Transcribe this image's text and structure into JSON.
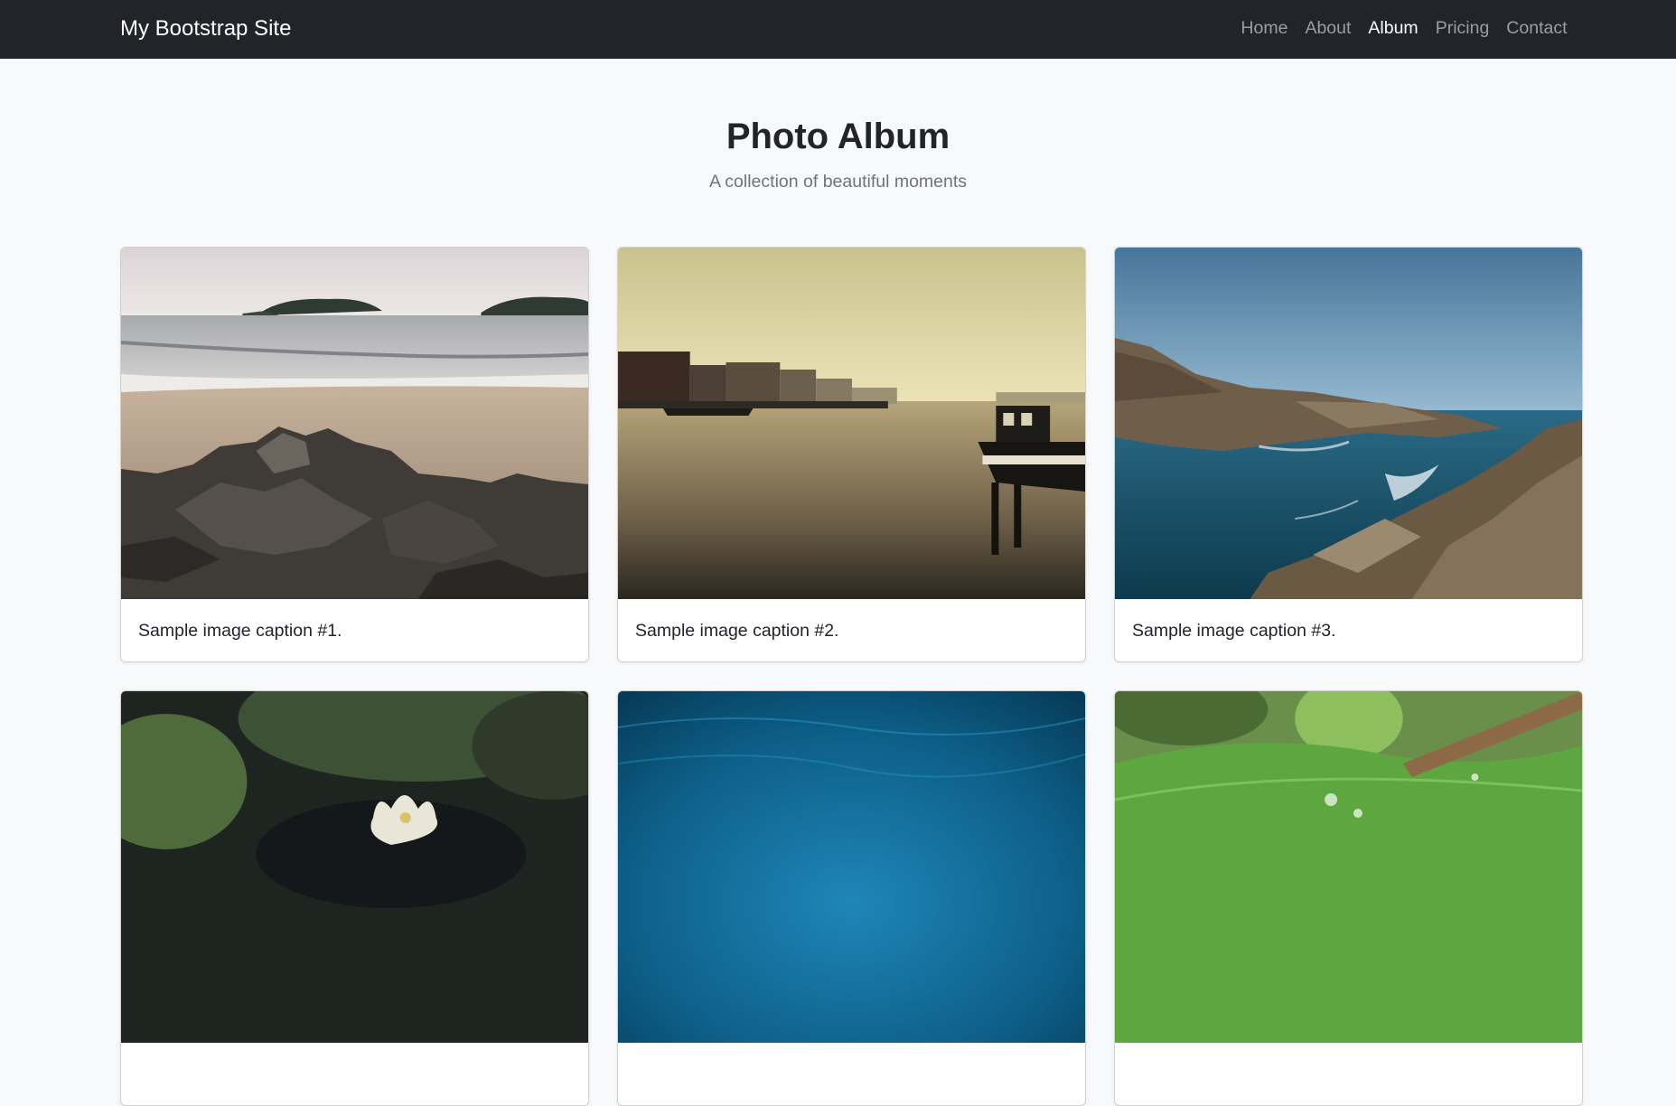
{
  "navbar": {
    "brand": "My Bootstrap Site",
    "links": [
      {
        "label": "Home",
        "active": false
      },
      {
        "label": "About",
        "active": false
      },
      {
        "label": "Album",
        "active": true
      },
      {
        "label": "Pricing",
        "active": false
      },
      {
        "label": "Contact",
        "active": false
      }
    ]
  },
  "header": {
    "title": "Photo Album",
    "subtitle": "A collection of beautiful moments"
  },
  "album": {
    "cards": [
      {
        "caption": "Sample image caption #1.",
        "photo": "beach-rocks-photo"
      },
      {
        "caption": "Sample image caption #2.",
        "photo": "harbor-boat-photo"
      },
      {
        "caption": "Sample image caption #3.",
        "photo": "rocky-coast-photo"
      },
      {
        "caption": "",
        "photo": "water-lily-photo"
      },
      {
        "caption": "",
        "photo": "underwater-blue-photo"
      },
      {
        "caption": "",
        "photo": "green-leaf-droplets-photo"
      }
    ]
  },
  "colors": {
    "navbar_bg": "#212529",
    "page_bg": "#f8f9fa",
    "muted_text": "#6c757d"
  }
}
